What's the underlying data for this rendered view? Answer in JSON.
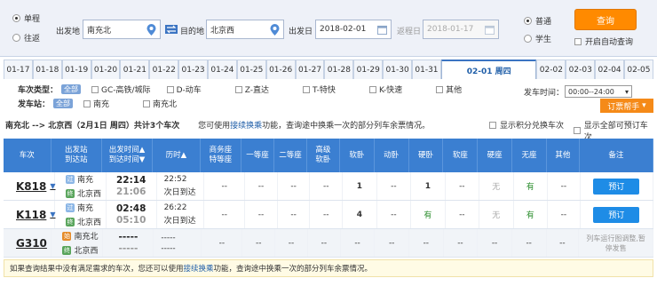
{
  "trip_type": {
    "single": "单程",
    "round": "往返"
  },
  "from": {
    "label": "出发地",
    "value": "南充北"
  },
  "to": {
    "label": "目的地",
    "value": "北京西"
  },
  "depart": {
    "label": "出发日",
    "value": "2018-02-01"
  },
  "return": {
    "label": "返程日",
    "value": "2018-01-17"
  },
  "ticket_type": {
    "normal": "普通",
    "student": "学生"
  },
  "search_button": "查询",
  "auto_query": "开启自动查询",
  "dates": [
    "01-17",
    "01-18",
    "01-19",
    "01-20",
    "01-21",
    "01-22",
    "01-23",
    "01-24",
    "01-25",
    "01-26",
    "01-27",
    "01-28",
    "01-29",
    "01-30",
    "01-31",
    "02-01 周四",
    "02-02",
    "02-03",
    "02-04",
    "02-05"
  ],
  "filters": {
    "type_label": "车次类型：",
    "all": "全部",
    "types": [
      "GC-高铁/城际",
      "D-动车",
      "Z-直达",
      "T-特快",
      "K-快速",
      "其他"
    ],
    "station_label": "发车站：",
    "stations": [
      "南充",
      "南充北"
    ],
    "time_label": "发车时间：",
    "time_value": "00:00--24:00"
  },
  "help_button": "订票帮手",
  "route": {
    "text": "南充北 --> 北京西（2月1日 周四）共计3个车次",
    "tip_pre": "您可使用",
    "tip_link": "接续换乘",
    "tip_post": "功能，查询途中换乘一次的部分列车余票情况。",
    "opt1": "显示积分兑换车次",
    "opt2": "显示全部可预订车次"
  },
  "headers": [
    "车次",
    "出发站\n到达站",
    "出发时间▲\n到达时间▼",
    "历时▲",
    "商务座\n特等座",
    "一等座",
    "二等座",
    "高级\n软卧",
    "软卧",
    "动卧",
    "硬卧",
    "软座",
    "硬座",
    "无座",
    "其他",
    "备注"
  ],
  "rows": [
    {
      "train": "K818",
      "from": "南充",
      "to": "北京西",
      "dep": "22:14",
      "arr": "21:06",
      "dur": "22:52",
      "arrive_day": "次日到达",
      "cells": [
        "--",
        "--",
        "--",
        "--",
        "1",
        "--",
        "1",
        "--",
        "无",
        "有",
        "--"
      ],
      "action": "预订"
    },
    {
      "train": "K118",
      "from": "南充",
      "to": "北京西",
      "dep": "02:48",
      "arr": "05:10",
      "dur": "26:22",
      "arrive_day": "次日到达",
      "cells": [
        "--",
        "--",
        "--",
        "--",
        "4",
        "--",
        "有",
        "--",
        "无",
        "有",
        "--"
      ],
      "action": "预订"
    },
    {
      "train": "G310",
      "from": "南充北",
      "to": "北京西",
      "dep": "-----",
      "arr": "-----",
      "dur": "-----",
      "arrive_day": "-----",
      "cells": [
        "--",
        "--",
        "--",
        "--",
        "--",
        "--",
        "--",
        "--",
        "--",
        "--",
        "--"
      ],
      "action": "列车运行图调整,暂停发售"
    }
  ],
  "note": {
    "pre": "如果查询结果中没有满足需求的车次，您还可以使用",
    "link": "接续换乘",
    "post": " 功能，查询途中换乘一次的部分列车余票情况。"
  }
}
